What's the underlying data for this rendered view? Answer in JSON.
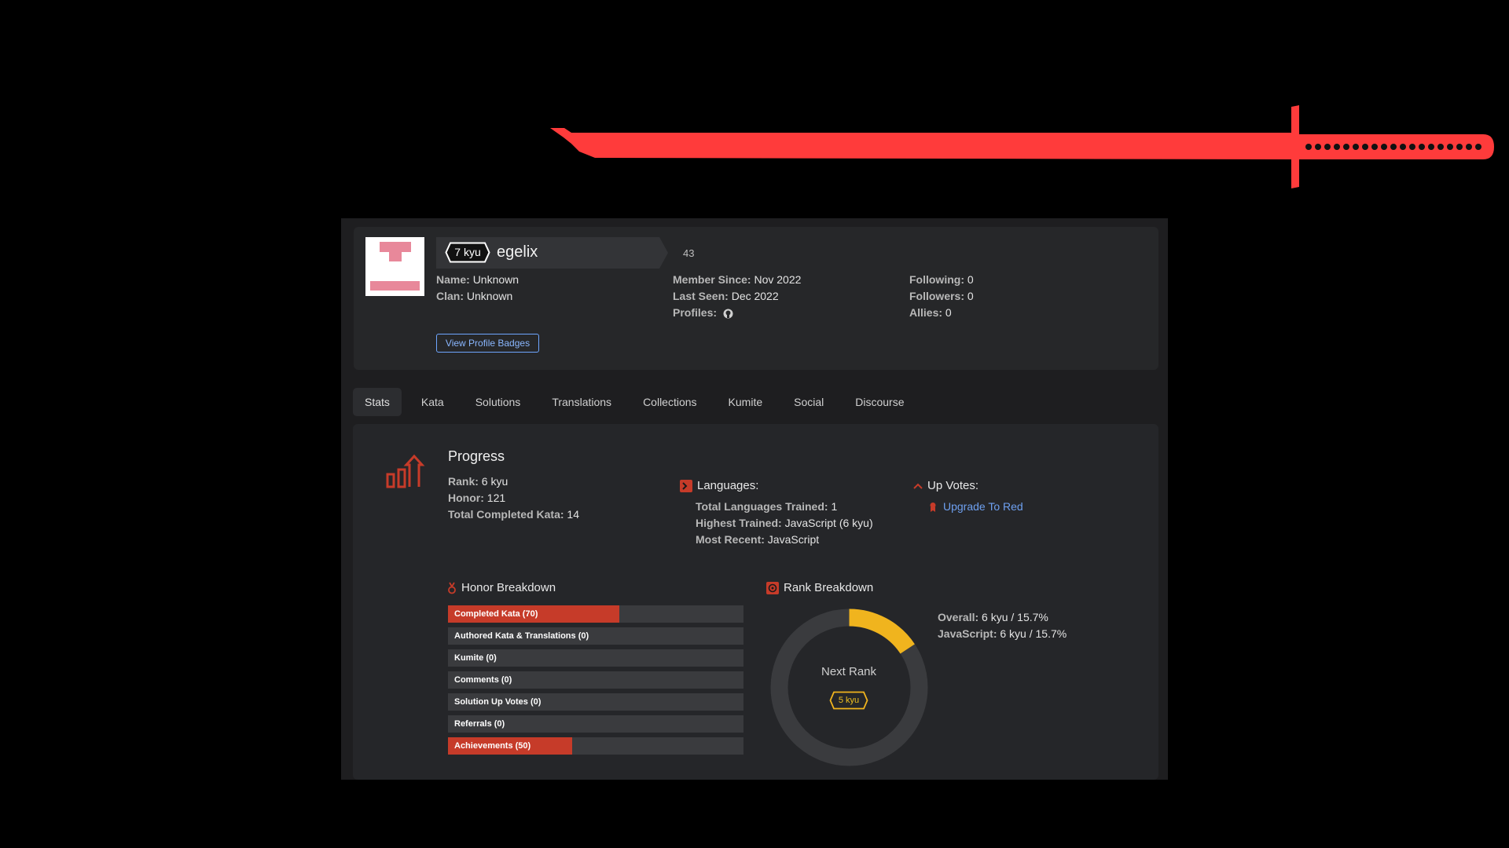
{
  "colors": {
    "accent": "#ff3b3b",
    "honor_bar_fill": "#c63b29",
    "bar_track": "#3a3b3e",
    "link": "#6ea0f0",
    "rank_progress": "#f0b41e"
  },
  "profile": {
    "rank_badge": "7 kyu",
    "username": "egelix",
    "honor": "43",
    "name_label": "Name:",
    "name_value": "Unknown",
    "clan_label": "Clan:",
    "clan_value": "Unknown",
    "member_since_label": "Member Since:",
    "member_since_value": "Nov 2022",
    "last_seen_label": "Last Seen:",
    "last_seen_value": "Dec 2022",
    "profiles_label": "Profiles:",
    "following_label": "Following:",
    "following_value": "0",
    "followers_label": "Followers:",
    "followers_value": "0",
    "allies_label": "Allies:",
    "allies_value": "0",
    "badges_button": "View Profile Badges"
  },
  "tabs": [
    "Stats",
    "Kata",
    "Solutions",
    "Translations",
    "Collections",
    "Kumite",
    "Social",
    "Discourse"
  ],
  "progress": {
    "title": "Progress",
    "rank_label": "Rank:",
    "rank_value": "6 kyu",
    "honor_label": "Honor:",
    "honor_value": "121",
    "completed_label": "Total Completed Kata:",
    "completed_value": "14"
  },
  "languages": {
    "title": "Languages:",
    "trained_label": "Total Languages Trained:",
    "trained_value": "1",
    "highest_label": "Highest Trained:",
    "highest_value": "JavaScript (6 kyu)",
    "recent_label": "Most Recent:",
    "recent_value": "JavaScript"
  },
  "upvotes": {
    "title": "Up Votes:",
    "link": "Upgrade To Red"
  },
  "honor_breakdown": {
    "title": "Honor Breakdown",
    "bars": [
      {
        "label": "Completed Kata (70)",
        "fraction": 0.58
      },
      {
        "label": "Authored Kata & Translations (0)",
        "fraction": 0
      },
      {
        "label": "Kumite (0)",
        "fraction": 0
      },
      {
        "label": "Comments (0)",
        "fraction": 0
      },
      {
        "label": "Solution Up Votes (0)",
        "fraction": 0
      },
      {
        "label": "Referrals (0)",
        "fraction": 0
      },
      {
        "label": "Achievements (50)",
        "fraction": 0.42
      }
    ]
  },
  "rank_breakdown": {
    "title": "Rank Breakdown",
    "next_rank_label": "Next Rank",
    "next_rank_badge": "5 kyu",
    "progress_fraction": 0.157,
    "overall_label": "Overall:",
    "overall_value": "6 kyu / 15.7%",
    "js_label": "JavaScript:",
    "js_value": "6 kyu / 15.7%"
  }
}
